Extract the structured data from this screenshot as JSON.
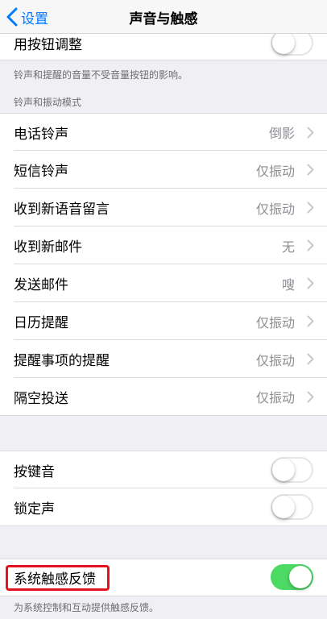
{
  "nav": {
    "back_label": "设置",
    "title": "声音与触感"
  },
  "top_row": {
    "label": "用按钮调整",
    "toggle_on": false
  },
  "top_footnote": "铃声和提醒的音量不受音量按钮的影响。",
  "ringtone_section": {
    "header": "铃声和振动模式",
    "items": [
      {
        "label": "电话铃声",
        "value": "倒影"
      },
      {
        "label": "短信铃声",
        "value": "仅振动"
      },
      {
        "label": "收到新语音留言",
        "value": "仅振动"
      },
      {
        "label": "收到新邮件",
        "value": "无"
      },
      {
        "label": "发送邮件",
        "value": "嗖"
      },
      {
        "label": "日历提醒",
        "value": "仅振动"
      },
      {
        "label": "提醒事项的提醒",
        "value": "仅振动"
      },
      {
        "label": "隔空投送",
        "value": "仅振动"
      }
    ]
  },
  "sound_section": {
    "items": [
      {
        "label": "按键音",
        "toggle_on": false
      },
      {
        "label": "锁定声",
        "toggle_on": false
      }
    ]
  },
  "haptic_section": {
    "label": "系统触感反馈",
    "toggle_on": true,
    "footnote": "为系统控制和互动提供触感反馈。"
  },
  "colors": {
    "accent": "#007aff",
    "toggle_on": "#4cd964",
    "highlight": "#e5111f",
    "background": "#efeff4"
  }
}
